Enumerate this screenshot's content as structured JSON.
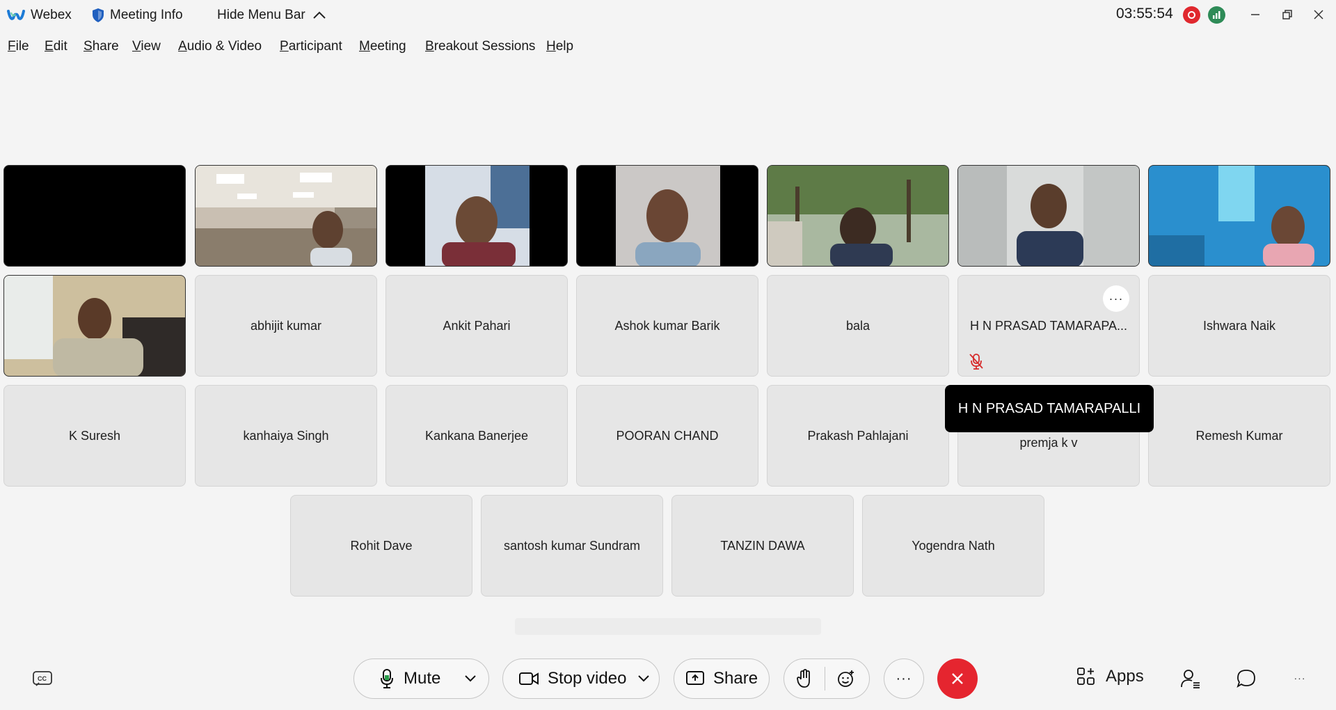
{
  "titlebar": {
    "app_name": "Webex",
    "meeting_info": "Meeting Info",
    "hide_menu_bar": "Hide Menu Bar",
    "clock": "03:55:54"
  },
  "menu": {
    "items": [
      {
        "label": "File",
        "u": "F",
        "rest": "ile"
      },
      {
        "label": "Edit",
        "u": "E",
        "rest": "dit"
      },
      {
        "label": "Share",
        "u": "S",
        "rest": "hare"
      },
      {
        "label": "View",
        "u": "V",
        "rest": "iew"
      },
      {
        "label": "Audio & Video",
        "u": "A",
        "rest": "udio & Video"
      },
      {
        "label": "Participant",
        "u": "P",
        "rest": "articipant"
      },
      {
        "label": "Meeting",
        "u": "M",
        "rest": "eeting"
      },
      {
        "label": "Breakout Sessions",
        "u": "B",
        "rest": "reakout Sessions"
      },
      {
        "label": "Help",
        "u": "H",
        "rest": "elp"
      }
    ]
  },
  "participants": {
    "names": [
      "abhijit kumar",
      "Ankit Pahari",
      "Ashok kumar Barik",
      "bala",
      "H N PRASAD TAMARAPA...",
      "Ishwara Naik",
      "K Suresh",
      "kanhaiya Singh",
      "Kankana Banerjee",
      "POORAN CHAND",
      "Prakash Pahlajani",
      "premja k v",
      "Remesh Kumar",
      "Rohit Dave",
      "santosh kumar Sundram",
      "TANZIN DAWA",
      "Yogendra Nath"
    ],
    "more_glyph": "···"
  },
  "tooltip": {
    "text": "H N PRASAD TAMARAPALLI"
  },
  "toolbar": {
    "mute": "Mute",
    "stop_video": "Stop video",
    "share": "Share",
    "apps": "Apps",
    "more_glyph": "···"
  },
  "colors": {
    "end_call": "#e5252f",
    "recording": "#e0282e",
    "network": "#2e8b57",
    "tile_bg": "#e6e6e6"
  }
}
